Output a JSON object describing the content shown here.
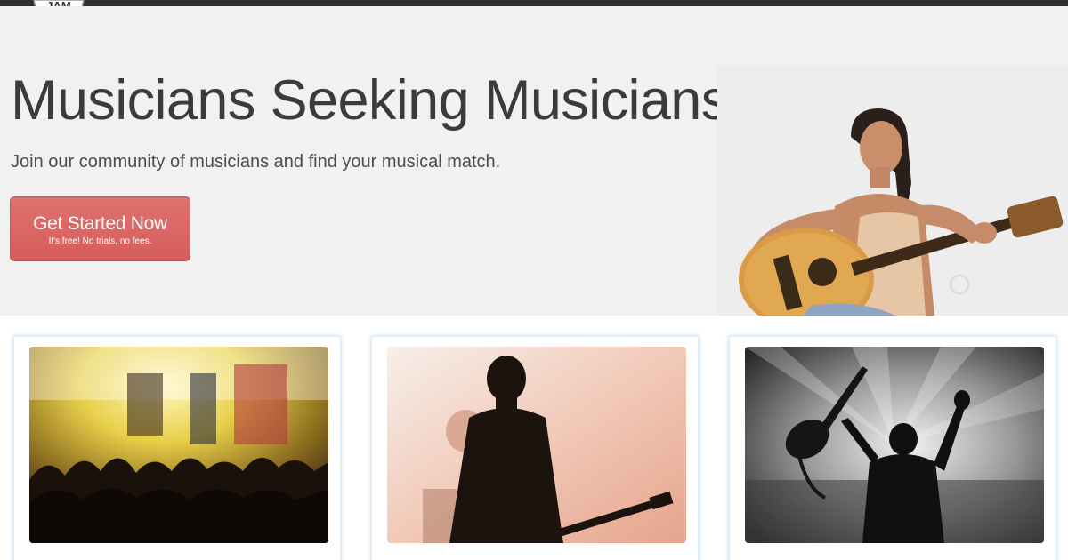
{
  "header": {
    "logo_text": "JAM"
  },
  "hero": {
    "title": "Musicians Seeking Musicians",
    "subtitle": "Join our community of musicians and find your musical match.",
    "cta_label": "Get Started Now",
    "cta_sublabel": "It's free! No trials, no fees."
  },
  "cards": [
    {
      "image": "concert-crowd-stage-photo"
    },
    {
      "image": "guitarist-silhouette-photo"
    },
    {
      "image": "crowd-raised-guitar-photo"
    }
  ]
}
